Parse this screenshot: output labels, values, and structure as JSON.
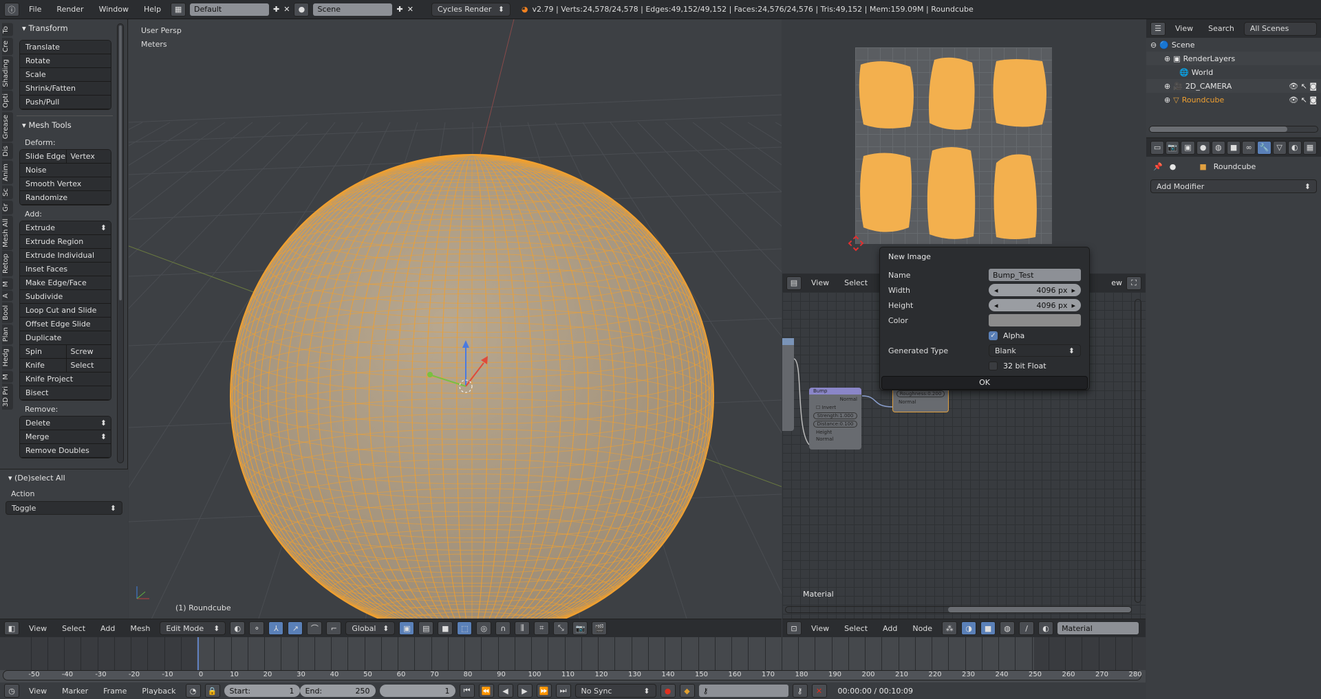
{
  "topbar": {
    "menus": [
      "File",
      "Render",
      "Window",
      "Help"
    ],
    "layout": "Default",
    "scene": "Scene",
    "engine": "Cycles Render",
    "stats": "v2.79 | Verts:24,578/24,578 | Edges:49,152/49,152 | Faces:24,576/24,576 | Tris:49,152 | Mem:159.09M | Roundcube"
  },
  "toolshelf": {
    "tabs": [
      "To",
      "Cre",
      "Shading",
      "Opti",
      "Grease",
      "Dis",
      "Anim",
      "Sc",
      "Gr",
      "Mesh All",
      "Retop",
      "M",
      "A",
      "Bool",
      "Plan",
      "Hedg",
      "M",
      "3D Pri"
    ],
    "transform": {
      "title": "Transform",
      "buttons": [
        "Translate",
        "Rotate",
        "Scale",
        "Shrink/Fatten",
        "Push/Pull"
      ]
    },
    "mesh_tools": {
      "title": "Mesh Tools",
      "deform_label": "Deform:",
      "slide_edge": "Slide Edge",
      "vertex": "Vertex",
      "deform": [
        "Noise",
        "Smooth Vertex",
        "Randomize"
      ],
      "add_label": "Add:",
      "extrude": "Extrude",
      "add": [
        "Extrude Region",
        "Extrude Individual",
        "Inset Faces",
        "Make Edge/Face",
        "Subdivide",
        "Loop Cut and Slide",
        "Offset Edge Slide",
        "Duplicate"
      ],
      "spin": "Spin",
      "screw": "Screw",
      "knife": "Knife",
      "select": "Select",
      "add2": [
        "Knife Project",
        "Bisect"
      ],
      "remove_label": "Remove:",
      "delete": "Delete",
      "merge": "Merge",
      "remove_doubles": "Remove Doubles"
    },
    "operator": {
      "title": "(De)select All",
      "action_label": "Action",
      "action_value": "Toggle"
    }
  },
  "viewport": {
    "view_name": "User Persp",
    "units": "Meters",
    "object_label": "(1) Roundcube",
    "mesh_color": "#f0a030",
    "header": {
      "menus": [
        "View",
        "Select",
        "Add",
        "Mesh"
      ],
      "mode": "Edit Mode",
      "orientation": "Global"
    }
  },
  "image_editor": {
    "header": {
      "menus": [
        "View",
        "Select"
      ],
      "view_suffix": "ew"
    }
  },
  "new_image_dialog": {
    "title": "New Image",
    "name_label": "Name",
    "name_value": "Bump_Test",
    "width_label": "Width",
    "width_value": "4096 px",
    "height_label": "Height",
    "height_value": "4096 px",
    "color_label": "Color",
    "alpha_label": "Alpha",
    "alpha_checked": true,
    "generated_type_label": "Generated Type",
    "generated_type_value": "Blank",
    "float_label": "32 bit Float",
    "float_checked": false,
    "ok_label": "OK"
  },
  "node_editor": {
    "tree_label": "Material",
    "bump_node": {
      "title": "Bump",
      "output": "Normal",
      "invert": "Invert",
      "strength": "Strength:1.000",
      "distance": "Distance:0.100",
      "height": "Height",
      "normal": "Normal"
    },
    "shader_node": {
      "roughness": "Roughness:0.200",
      "normal": "Normal"
    },
    "header": {
      "menus": [
        "View",
        "Select",
        "Add",
        "Node"
      ],
      "material": "Material"
    }
  },
  "outliner": {
    "header": {
      "menus": [
        "View",
        "Search"
      ],
      "filter": "All Scenes"
    },
    "items": [
      {
        "label": "Scene"
      },
      {
        "label": "RenderLayers"
      },
      {
        "label": "World"
      },
      {
        "label": "2D_CAMERA"
      },
      {
        "label": "Roundcube"
      }
    ]
  },
  "properties": {
    "object": "Roundcube",
    "add_modifier": "Add Modifier"
  },
  "timeline": {
    "ticks": [
      -50,
      -40,
      -30,
      -20,
      -10,
      0,
      10,
      20,
      30,
      40,
      50,
      60,
      70,
      80,
      90,
      100,
      110,
      120,
      130,
      140,
      150,
      160,
      170,
      180,
      190,
      200,
      210,
      220,
      230,
      240,
      250,
      260,
      270,
      280
    ],
    "current_frame": 1,
    "header": {
      "menus": [
        "View",
        "Marker",
        "Frame",
        "Playback"
      ],
      "start_label": "Start:",
      "start": "1",
      "end_label": "End:",
      "end": "250",
      "frame": "1",
      "sync": "No Sync",
      "time": "00:00:00 / 00:10:09"
    }
  }
}
